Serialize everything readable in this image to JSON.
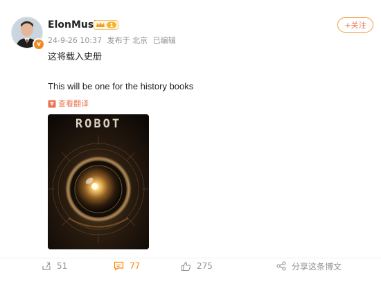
{
  "post": {
    "author": "ElonMusk",
    "vip_level": "1",
    "avatar_badge": "v",
    "timestamp": "24-9-26 10:37",
    "location": "发布于 北京",
    "edited": "已编辑",
    "follow_label": "+关注",
    "text_cn": "这将载入史册",
    "text_en": "This will be one for the history books",
    "translate_label": "查看翻译",
    "image_title": "ROBOT"
  },
  "actions": {
    "repost_count": "51",
    "comment_count": "77",
    "like_count": "275",
    "share_label": "分享这条博文"
  },
  "colors": {
    "accent": "#eb7350",
    "comment_active": "#ff8200",
    "badge": "#f08a24",
    "muted": "#939393"
  }
}
